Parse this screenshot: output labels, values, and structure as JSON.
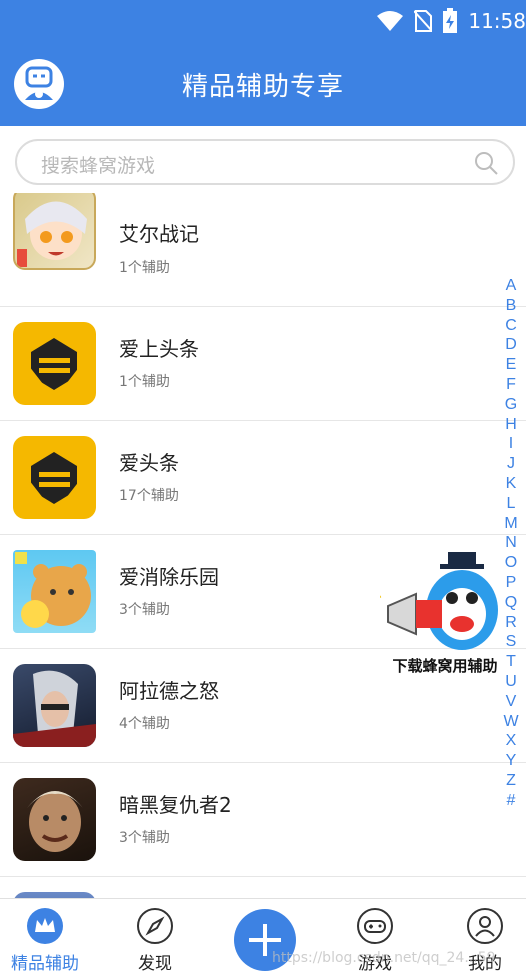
{
  "status_bar": {
    "time": "11:58"
  },
  "header": {
    "title": "精品辅助专享"
  },
  "search": {
    "placeholder": "搜索蜂窝游戏"
  },
  "games": [
    {
      "name": "艾尔战记",
      "count": "1个辅助",
      "icon": "anime-girl-avatar"
    },
    {
      "name": "爱上头条",
      "count": "1个辅助",
      "icon": "bee-logo"
    },
    {
      "name": "爱头条",
      "count": "17个辅助",
      "icon": "bee-logo"
    },
    {
      "name": "爱消除乐园",
      "count": "3个辅助",
      "icon": "bear-avatar"
    },
    {
      "name": "阿拉德之怒",
      "count": "4个辅助",
      "icon": "warrior-avatar"
    },
    {
      "name": "暗黑复仇者2",
      "count": "3个辅助",
      "icon": "monster-avatar"
    }
  ],
  "index_letters": [
    "A",
    "B",
    "C",
    "D",
    "E",
    "F",
    "G",
    "H",
    "I",
    "J",
    "K",
    "L",
    "M",
    "N",
    "O",
    "P",
    "Q",
    "R",
    "S",
    "T",
    "U",
    "V",
    "W",
    "X",
    "Y",
    "Z",
    "#"
  ],
  "promo": {
    "text": "下载蜂窝用辅助"
  },
  "tabs": [
    {
      "label": "精品辅助",
      "icon": "crown-icon",
      "active": true
    },
    {
      "label": "发现",
      "icon": "compass-icon",
      "active": false
    },
    {
      "label": "",
      "icon": "plus-icon",
      "active": false
    },
    {
      "label": "游戏",
      "icon": "gamepad-icon",
      "active": false
    },
    {
      "label": "我的",
      "icon": "user-icon",
      "active": false
    }
  ],
  "watermark": "https://blog.csdn.net/qq_24...59",
  "colors": {
    "accent": "#3d82e3",
    "bee_yellow": "#f5b800"
  }
}
